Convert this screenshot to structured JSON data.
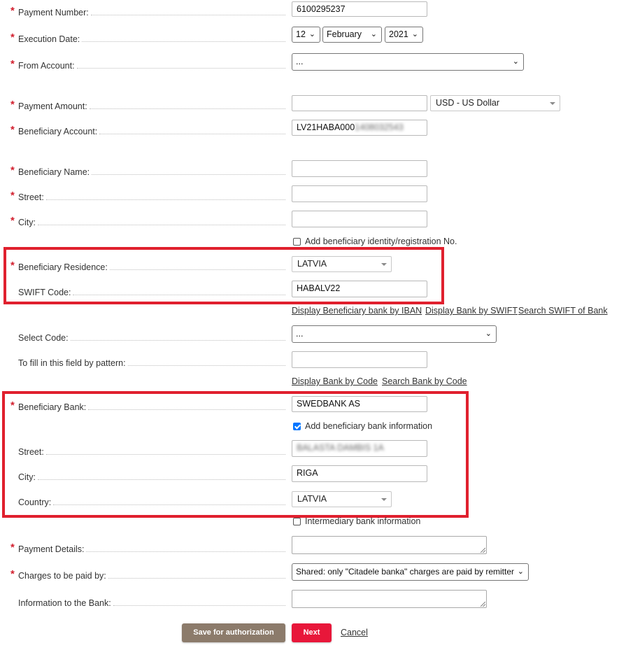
{
  "form": {
    "payment_number": {
      "label": "Payment Number:",
      "value": "6100295237"
    },
    "execution_date": {
      "label": "Execution Date:",
      "day": "12",
      "month": "February",
      "year": "2021"
    },
    "from_account": {
      "label": "From Account:",
      "value": "..."
    },
    "payment_amount": {
      "label": "Payment Amount:",
      "value": "",
      "currency": "USD - US Dollar"
    },
    "beneficiary_account": {
      "label": "Beneficiary Account:",
      "value_visible": "LV21HABA000",
      "value_blurred": "1408032543"
    },
    "beneficiary_name": {
      "label": "Beneficiary Name:",
      "value": ""
    },
    "street": {
      "label": "Street:",
      "value": ""
    },
    "city": {
      "label": "City:",
      "value": ""
    },
    "add_identity": {
      "label": "Add beneficiary identity/registration No.",
      "checked": false
    },
    "beneficiary_residence": {
      "label": "Beneficiary Residence:",
      "value": "LATVIA"
    },
    "swift_code": {
      "label": "SWIFT Code:",
      "value": "HABALV22"
    },
    "links_swift": {
      "by_iban": "Display Beneficiary bank by IBAN",
      "by_swift": "Display Bank by SWIFT",
      "search_swift": "Search SWIFT of Bank"
    },
    "select_code": {
      "label": "Select Code:",
      "value": "..."
    },
    "pattern_field": {
      "label": "To fill in this field by pattern:",
      "value": ""
    },
    "links_code": {
      "display_by_code": "Display Bank by Code",
      "search_by_code": "Search Bank by Code"
    },
    "beneficiary_bank": {
      "label": "Beneficiary Bank:",
      "value": "SWEDBANK AS"
    },
    "add_bank_info": {
      "label": "Add beneficiary bank information",
      "checked": true
    },
    "bank_street": {
      "label": "Street:",
      "value_blurred": "BALASTA DAMBIS 1A"
    },
    "bank_city": {
      "label": "City:",
      "value": "RIGA"
    },
    "bank_country": {
      "label": "Country:",
      "value": "LATVIA"
    },
    "intermediary": {
      "label": "Intermediary bank information",
      "checked": false
    },
    "payment_details": {
      "label": "Payment Details:",
      "value": ""
    },
    "charges": {
      "label": "Charges to be paid by:",
      "value": "Shared: only \"Citadele banka\" charges are paid by remitter"
    },
    "info_to_bank": {
      "label": "Information to the Bank:",
      "value": ""
    }
  },
  "actions": {
    "save_label": "Save for authorization",
    "next_label": "Next",
    "cancel_label": "Cancel"
  },
  "colors": {
    "required": "#d21f2e",
    "highlight": "#e0202e",
    "save_button": "#8c7b6b",
    "next_button": "#e8173a"
  }
}
